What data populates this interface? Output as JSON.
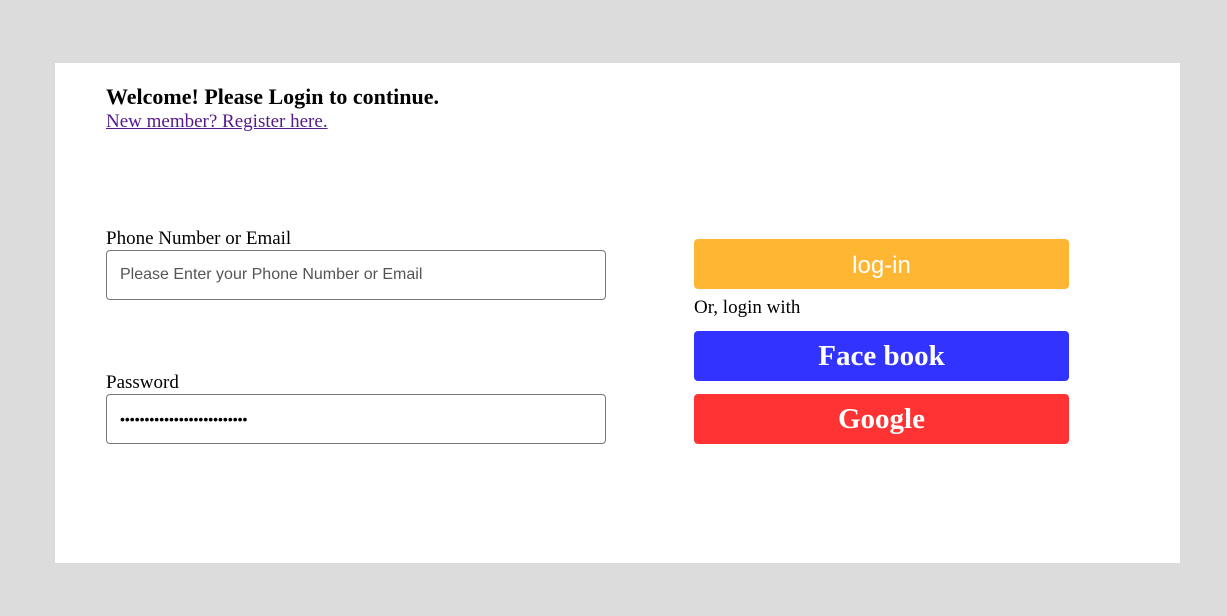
{
  "header": {
    "title": "Welcome! Please Login to continue.",
    "register_link": "New member? Register here."
  },
  "form": {
    "phone_label": "Phone Number or Email",
    "phone_placeholder": "Please Enter your Phone Number or Email",
    "phone_value": "",
    "password_label": "Password",
    "password_value": "••••••••••••••••••••••••••"
  },
  "actions": {
    "login_label": "log-in",
    "or_text": "Or, login with",
    "facebook_label": "Face book",
    "google_label": "Google"
  },
  "colors": {
    "page_background": "#dcdcdc",
    "card_background": "#ffffff",
    "login_button": "#ffb733",
    "facebook_button": "#3333ff",
    "google_button": "#ff3333",
    "link": "#551a8b"
  }
}
